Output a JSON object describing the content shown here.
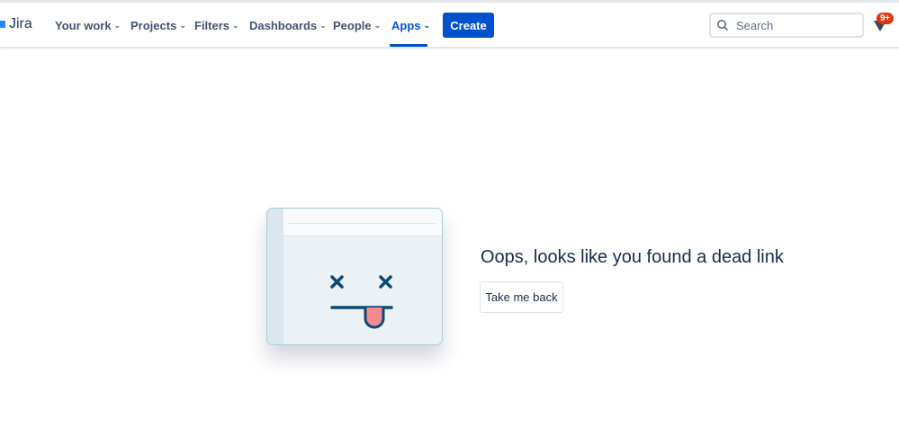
{
  "header": {
    "logo": "Jira",
    "nav": [
      {
        "label": "Your work"
      },
      {
        "label": "Projects"
      },
      {
        "label": "Filters"
      },
      {
        "label": "Dashboards"
      },
      {
        "label": "People"
      },
      {
        "label": "Apps",
        "active": true
      }
    ],
    "create_label": "Create",
    "search_placeholder": "Search",
    "notification_badge": "9+"
  },
  "main": {
    "message": "Oops, looks like you found a dead link",
    "back_label": "Take me back"
  },
  "colors": {
    "brand": "#0052cc",
    "badge": "#de350b",
    "illustration_stroke": "#0b4a78",
    "tongue": "#f28b8e"
  }
}
